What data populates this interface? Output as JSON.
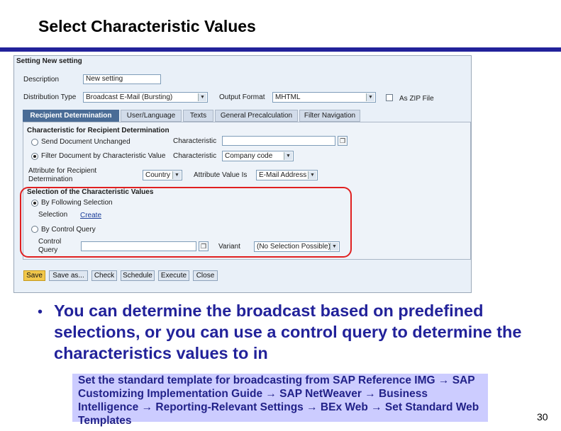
{
  "slide": {
    "title": "Select Characteristic Values",
    "page_number": "30",
    "bullet_symbol": "•",
    "body_text": "You can determine the broadcast based on predefined selections, or you can use a control query to determine the characteristics values to in",
    "note_text": "Set the standard template for broadcasting from SAP Reference IMG → SAP Customizing Implementation Guide → SAP NetWeaver → Business Intelligence → Reporting-Relevant Settings → BEx Web → Set Standard Web Templates"
  },
  "sap": {
    "panel_title": "Setting New setting",
    "description_label": "Description",
    "description_value": "New setting",
    "distribution_type_label": "Distribution Type",
    "distribution_type_value": "Broadcast E-Mail (Bursting)",
    "output_format_label": "Output Format",
    "output_format_value": "MHTML",
    "as_zip_label": "As ZIP File",
    "tabs": [
      {
        "label": "Recipient Determination",
        "active": true
      },
      {
        "label": "User/Language"
      },
      {
        "label": "Texts"
      },
      {
        "label": "General Precalculation"
      },
      {
        "label": "Filter Navigation"
      }
    ],
    "recipient_section_title": "Characteristic for Recipient Determination",
    "send_unchanged_label": "Send Document Unchanged",
    "filter_by_char_label": "Filter Document by Characteristic Value",
    "characteristic_label_1": "Characteristic",
    "characteristic_label_2": "Characteristic",
    "characteristic_value": "Company code",
    "attribute_label_line1": "Attribute for Recipient",
    "attribute_label_line2": "Determination",
    "attribute_value": "Country",
    "attribute_value_is_label": "Attribute Value Is",
    "attribute_value_is_value": "E-Mail Address",
    "selection_section_title": "Selection of the Characteristic Values",
    "by_following_selection_label": "By Following Selection",
    "selection_label": "Selection",
    "create_link": "Create",
    "by_control_query_label": "By Control Query",
    "control_query_label_line1": "Control",
    "control_query_label_line2": "Query",
    "variant_label": "Variant",
    "variant_value": "(No Selection Possible)",
    "buttons": {
      "save": "Save",
      "save_as": "Save as...",
      "check": "Check",
      "schedule": "Schedule",
      "execute": "Execute",
      "close": "Close"
    }
  },
  "colors": {
    "title_rule": "#22229a",
    "body_text": "#22229a",
    "note_background": "#ccccff",
    "highlight": "#e02020",
    "active_tab": "#4a6c96"
  },
  "icons": {
    "dropdown": "chevron-down-icon",
    "value_help": "value-help-icon",
    "bullet": "bullet-icon"
  }
}
